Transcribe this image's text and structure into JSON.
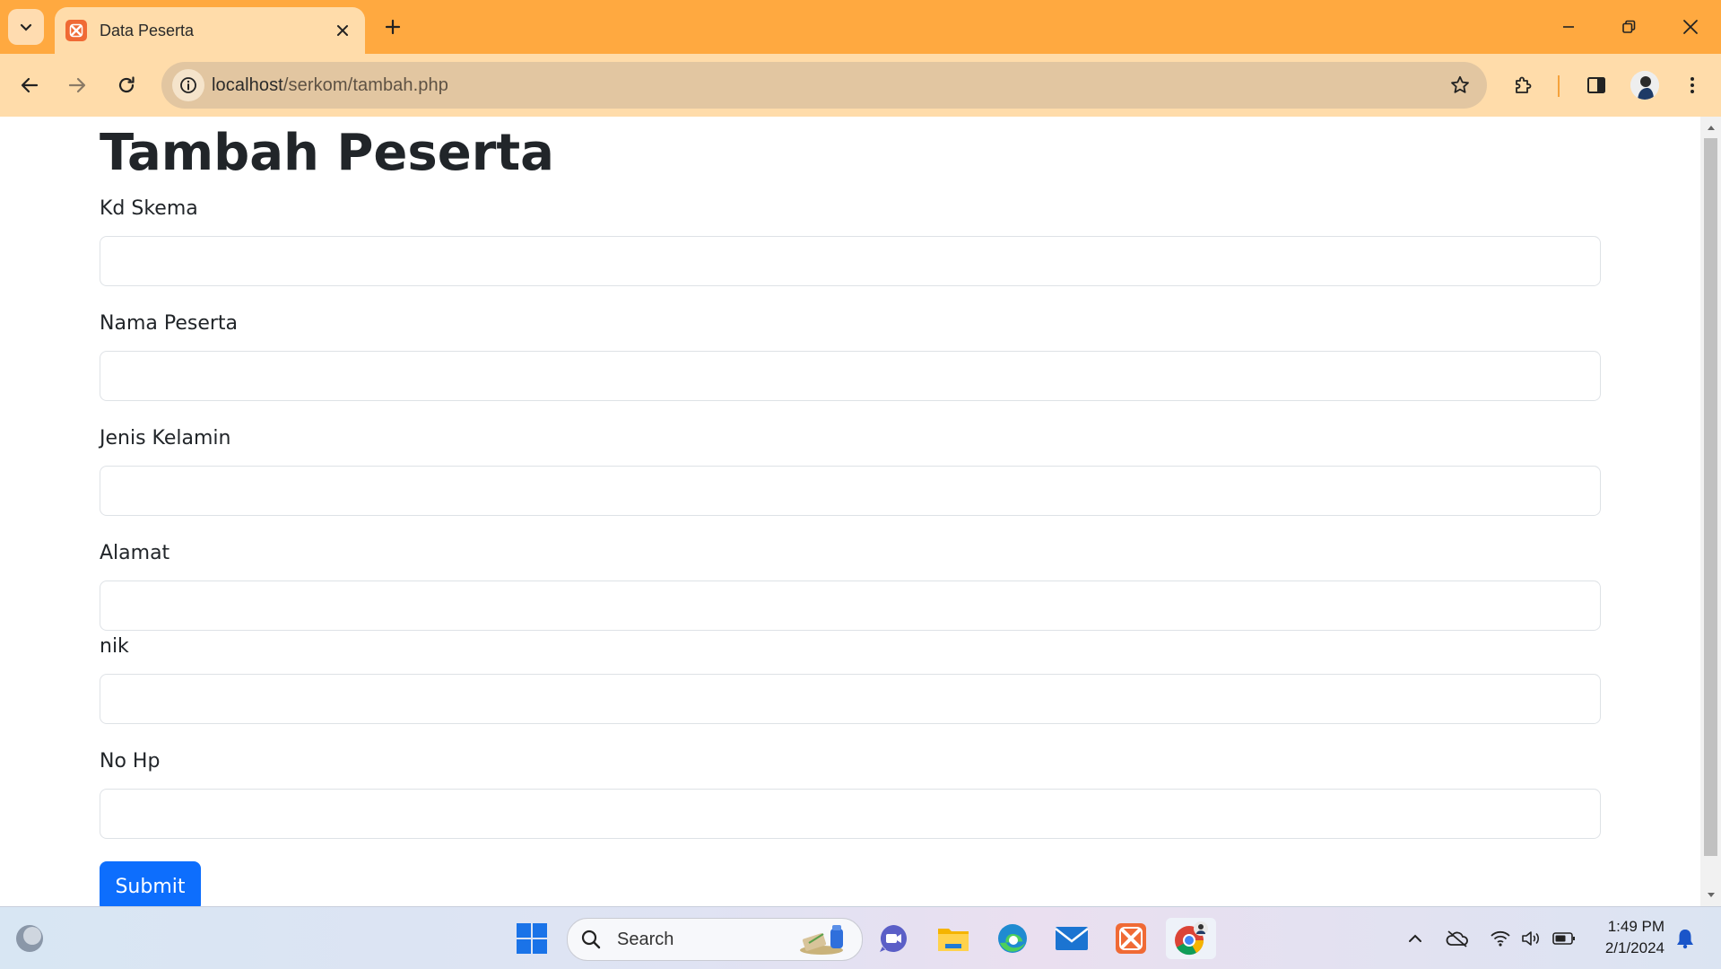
{
  "browser": {
    "tab": {
      "title": "Data Peserta"
    },
    "address_bar": {
      "host": "localhost",
      "path": "/serkom/tambah.php"
    },
    "accent_color": "#ffa940"
  },
  "page": {
    "heading": "Tambah Peserta",
    "fields": [
      {
        "label": "Kd Skema",
        "value": ""
      },
      {
        "label": "Nama Peserta",
        "value": ""
      },
      {
        "label": "Jenis Kelamin",
        "value": ""
      },
      {
        "label": "Alamat",
        "value": ""
      },
      {
        "label": "nik",
        "value": ""
      },
      {
        "label": "No Hp",
        "value": ""
      }
    ],
    "submit_label": "Submit",
    "submit_color": "#0d6efd"
  },
  "taskbar": {
    "search_placeholder": "Search",
    "pinned_icons": [
      "start-icon",
      "search-icon",
      "meet-icon",
      "file-explorer-icon",
      "edge-icon",
      "mail-icon",
      "xampp-icon",
      "chrome-icon"
    ],
    "clock": {
      "time": "1:49 PM",
      "date": "2/1/2024"
    }
  }
}
